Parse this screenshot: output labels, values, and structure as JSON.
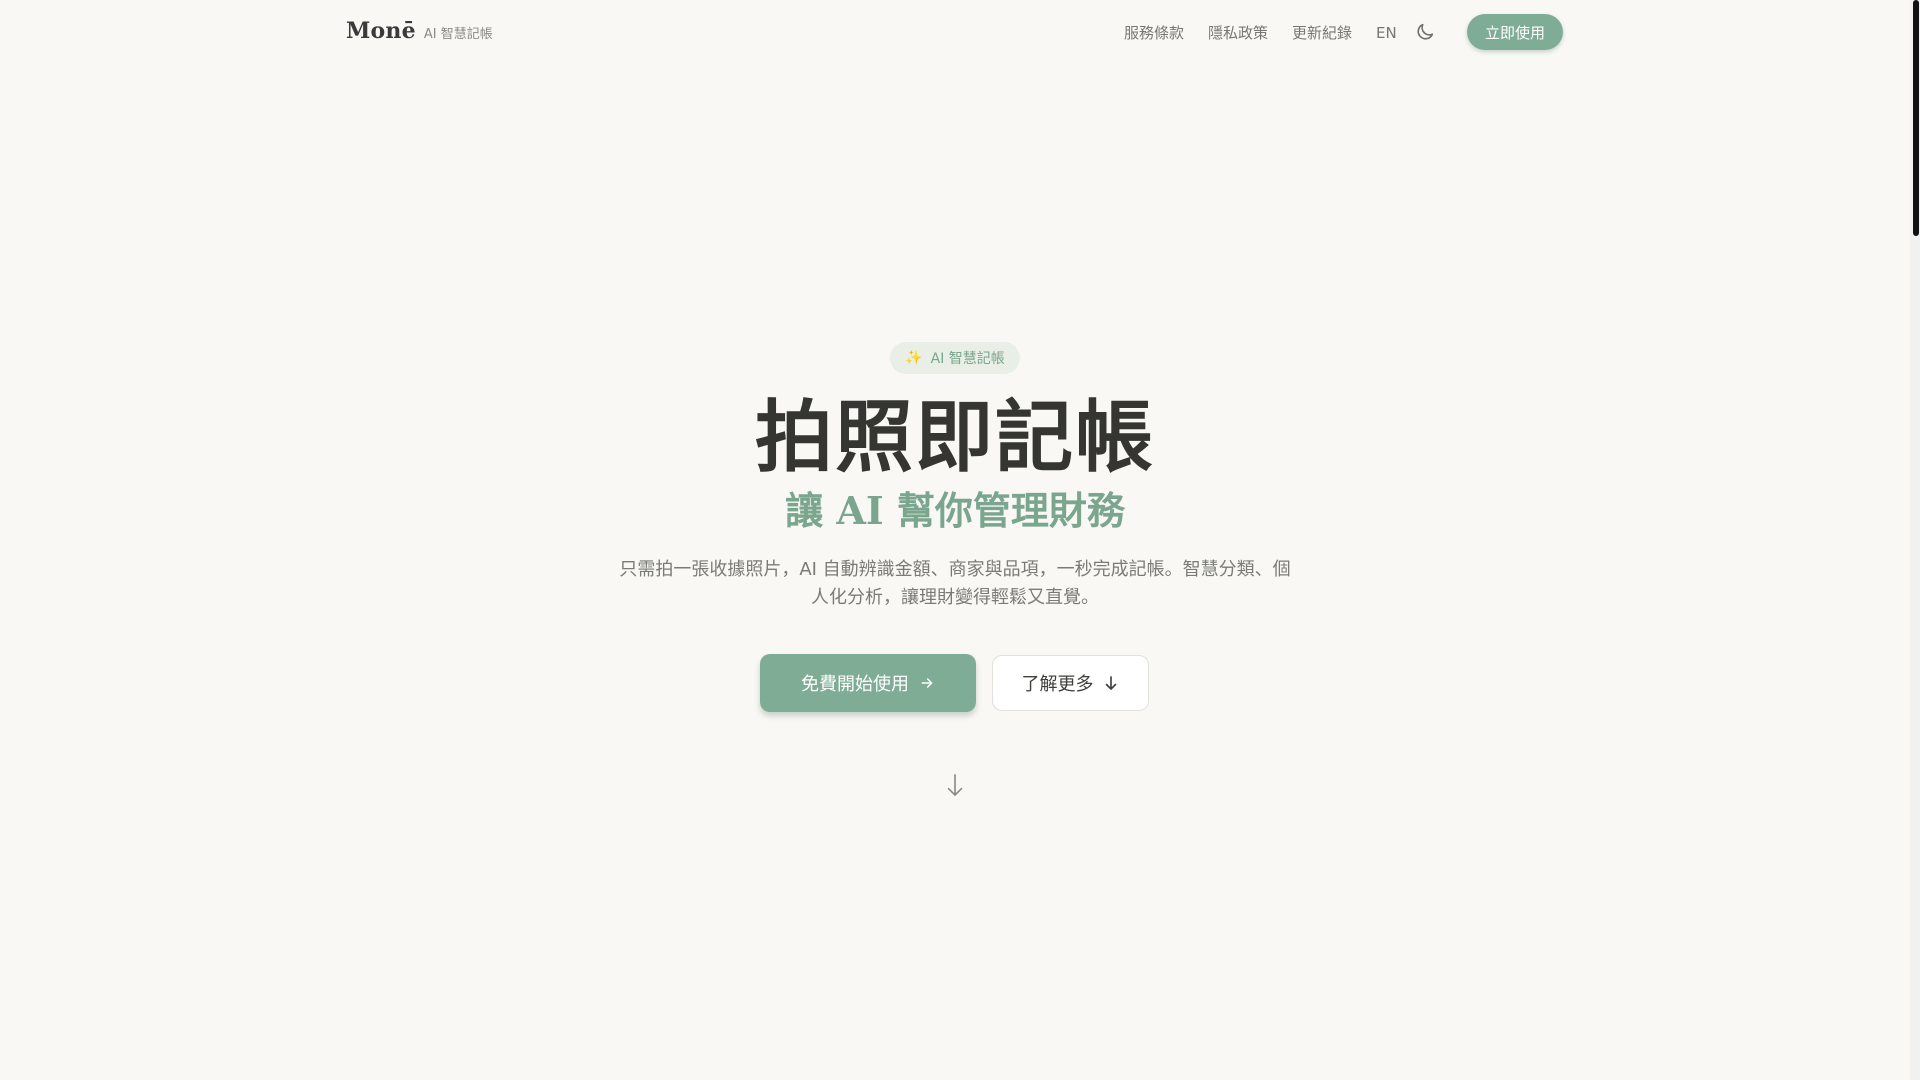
{
  "header": {
    "brand_name": "Monē",
    "brand_tagline": "AI 智慧記帳",
    "nav": {
      "terms": "服務條款",
      "privacy": "隱私政策",
      "changelog": "更新紀錄",
      "language": "EN"
    },
    "theme_icon": "moon-icon",
    "cta_label": "立即使用"
  },
  "hero": {
    "badge_icon": "sparkles-icon",
    "badge_label": "AI 智慧記帳",
    "title": "拍照即記帳",
    "subtitle": "讓 AI 幫你管理財務",
    "description": "只需拍一張收據照片，AI 自動辨識金額、商家與品項，一秒完成記帳。智慧分類、個人化分析，讓理財變得輕鬆又直覺。",
    "primary_button": "免費開始使用",
    "secondary_button": "了解更多"
  },
  "colors": {
    "background": "#f9f8f5",
    "accent": "#7fac94",
    "accent_text": "#7aa68d",
    "title": "#353532"
  }
}
